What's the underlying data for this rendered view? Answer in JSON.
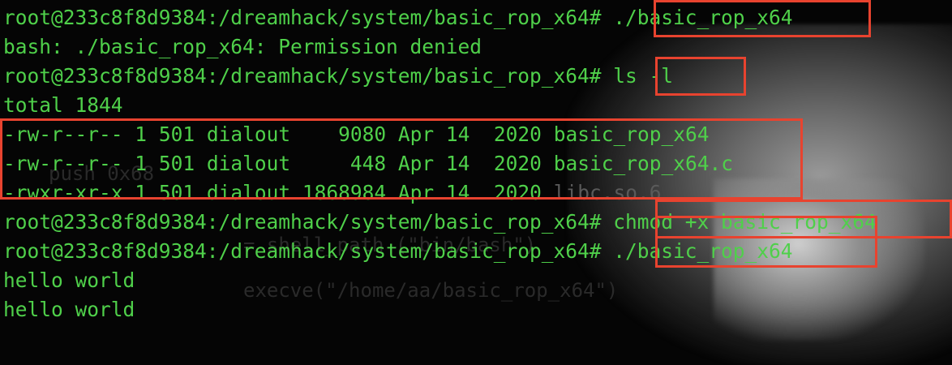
{
  "prompt": "root@233c8f8d9384:/dreamhack/system/basic_rop_x64#",
  "lines": [
    {
      "type": "cmd",
      "command": "./basic_rop_x64"
    },
    {
      "type": "out",
      "text": "bash: ./basic_rop_x64: Permission denied"
    },
    {
      "type": "cmd",
      "command": "ls -l"
    },
    {
      "type": "out",
      "text": "total 1844"
    },
    {
      "type": "ls",
      "perm": "-rw-r--r--",
      "links": "1",
      "owner": "501",
      "group": "dialout",
      "size": "9080",
      "date": "Apr 14  2020",
      "name": "basic_rop_x64"
    },
    {
      "type": "ls",
      "perm": "-rw-r--r--",
      "links": "1",
      "owner": "501",
      "group": "dialout",
      "size": "448",
      "date": "Apr 14  2020",
      "name": "basic_rop_x64.c"
    },
    {
      "type": "ls",
      "perm": "-rwxr-xr-x",
      "links": "1",
      "owner": "501",
      "group": "dialout",
      "size": "1868984",
      "date": "Apr 14  2020",
      "name": "libc.so.6"
    },
    {
      "type": "cmd",
      "command": "chmod +x basic_rop_x64"
    },
    {
      "type": "cmd",
      "command": "./basic_rop_x64"
    },
    {
      "type": "out",
      "text": "hello world"
    },
    {
      "type": "out",
      "text": "hello world"
    }
  ],
  "background_ghost_text": [
    "push 0x68",
    "= shell_path (\"bin/bash\")",
    "execve(\"/home/aa/basic_rop_x64\")"
  ],
  "colors": {
    "text": "#4fd04a",
    "highlight_box": "#e8432f",
    "background": "#050505"
  }
}
